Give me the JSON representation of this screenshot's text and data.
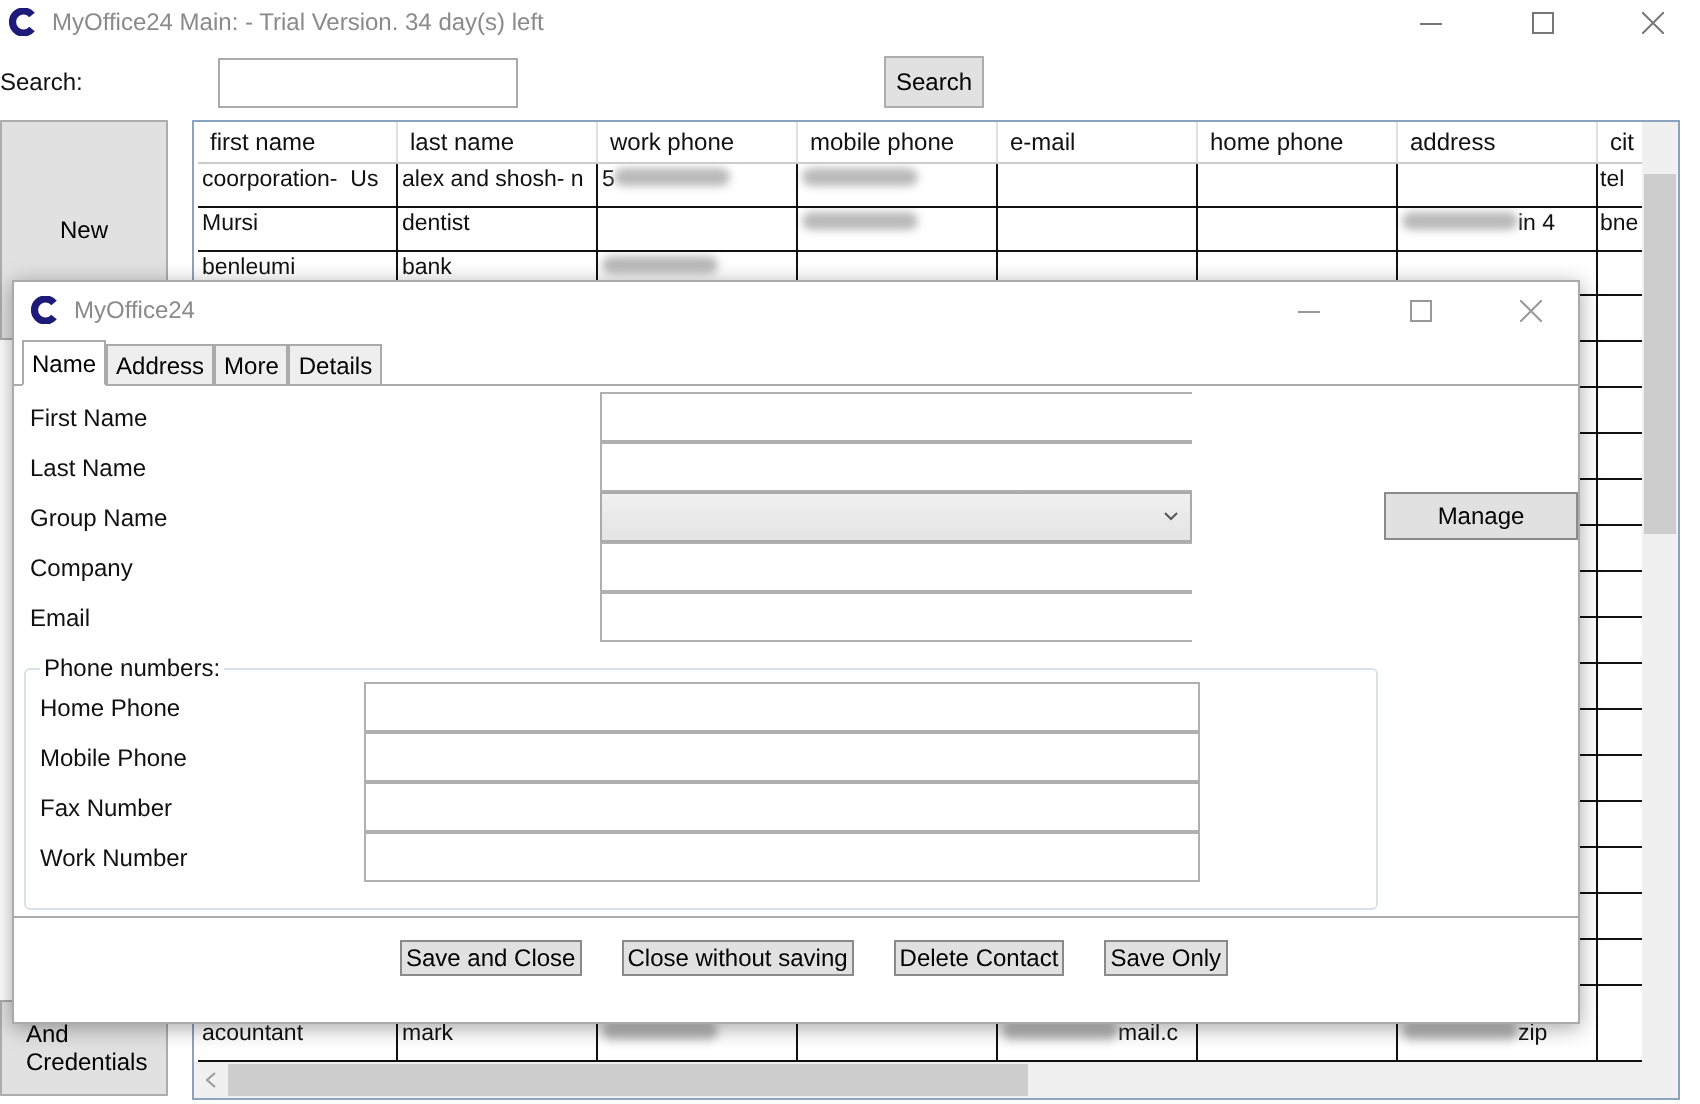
{
  "main_window": {
    "title": "MyOffice24 Main: - Trial Version. 34 day(s) left"
  },
  "search": {
    "label": "Search:",
    "button": "Search"
  },
  "side_buttons": [
    "New",
    "And Credentials"
  ],
  "table": {
    "columns": [
      "first name",
      "last name",
      "work phone",
      "mobile phone",
      "e-mail",
      "home phone",
      "address",
      "cit"
    ],
    "rows": [
      {
        "cells": [
          {
            "text": "coorporation-  Us"
          },
          {
            "text": "alex and shosh- n"
          },
          {
            "text": "5",
            "blurred": true
          },
          {
            "blurred": true
          },
          {},
          {},
          {},
          {
            "text": "tel"
          }
        ]
      },
      {
        "cells": [
          {
            "text": "Mursi"
          },
          {
            "text": "dentist"
          },
          {},
          {
            "blurred": true
          },
          {},
          {},
          {
            "text": "in 4",
            "blurred": true
          },
          {
            "text": "bne"
          }
        ]
      },
      {
        "cells": [
          {
            "text": "benleumi"
          },
          {
            "text": "bank"
          },
          {
            "blurred": true
          },
          {},
          {},
          {},
          {},
          {}
        ]
      }
    ],
    "last_row": {
      "cells": [
        {
          "text": "acountant"
        },
        {
          "text": "mark"
        },
        {
          "blurred": true
        },
        {},
        {
          "text": "mail.c",
          "blurred": true
        },
        {},
        {
          "text": "zip",
          "blurred": true
        },
        {}
      ]
    }
  },
  "dialog": {
    "title": "MyOffice24",
    "tabs": [
      {
        "label": "Name",
        "selected": true
      },
      {
        "label": "Address",
        "selected": false
      },
      {
        "label": "More",
        "selected": false
      },
      {
        "label": "Details",
        "selected": false
      }
    ],
    "fields": [
      {
        "label": "First Name",
        "kind": "text"
      },
      {
        "label": "Last Name",
        "kind": "text"
      },
      {
        "label": "Group Name",
        "kind": "dropdown"
      },
      {
        "label": "Company",
        "kind": "text"
      },
      {
        "label": "Email",
        "kind": "text"
      }
    ],
    "manage_button": "Manage",
    "phone_group": {
      "title": "Phone numbers:",
      "fields": [
        "Home Phone",
        "Mobile Phone",
        "Fax Number",
        "Work Number"
      ]
    },
    "buttons": [
      "Save and Close",
      "Close without saving",
      "Delete Contact",
      "Save Only"
    ]
  }
}
